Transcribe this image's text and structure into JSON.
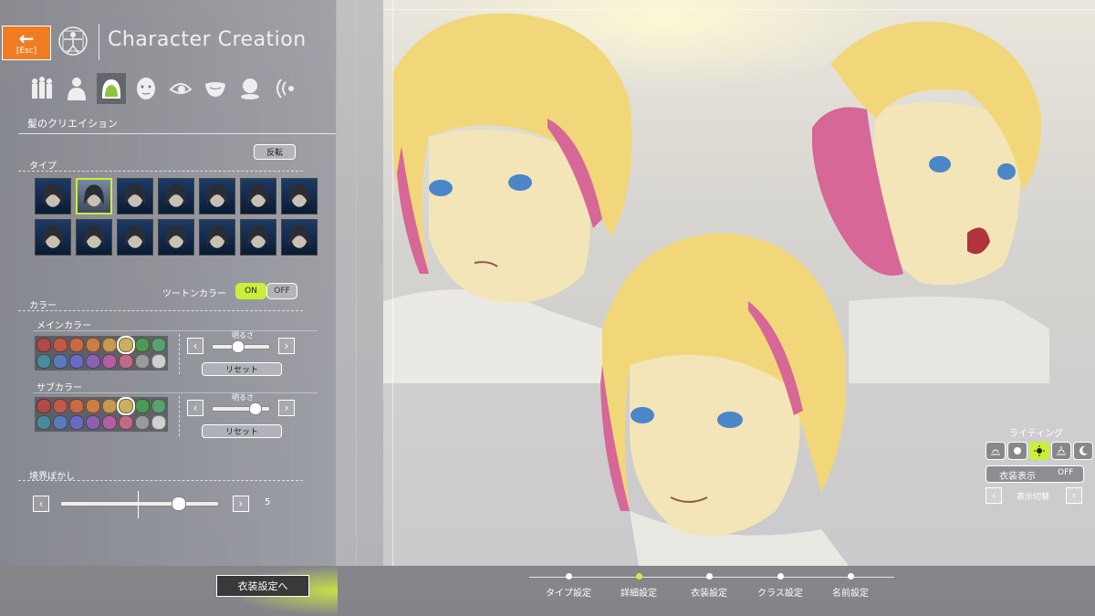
{
  "header": {
    "esc_label": "[Esc]",
    "title": "Character Creation"
  },
  "tabs": [
    {
      "icon": "body-parts-icon",
      "active": false
    },
    {
      "icon": "body-icon",
      "active": false
    },
    {
      "icon": "hair-icon",
      "active": true
    },
    {
      "icon": "face-icon",
      "active": false
    },
    {
      "icon": "eye-icon",
      "active": false
    },
    {
      "icon": "mouth-icon",
      "active": false
    },
    {
      "icon": "makeup-icon",
      "active": false
    },
    {
      "icon": "voice-icon",
      "active": false
    }
  ],
  "panel": {
    "section_title": "髪のクリエイション",
    "flip_button": "反転",
    "type_label": "タイプ",
    "hair_selected_index": 1,
    "two_tone_label": "ツートンカラー",
    "two_tone_on": "ON",
    "two_tone_off": "OFF",
    "color_label": "カラー",
    "main_color_label": "メインカラー",
    "sub_color_label": "サブカラー",
    "brightness_label": "明るさ",
    "reset_label": "リセット",
    "main_brightness": 0.45,
    "sub_brightness": 0.75,
    "blur_label": "境界ぼかし",
    "blur_value": "5",
    "blur_fraction": 0.75
  },
  "swatch_colors": [
    "#b04a4a",
    "#c25a4a",
    "#c86a44",
    "#c87f44",
    "#c89a50",
    "#c8b060",
    "#4e9a54",
    "#5aa070",
    "#4a8a9a",
    "#5a7ab8",
    "#6a6ac0",
    "#8a62b0",
    "#b060a0",
    "#c06a88",
    "#9a9a9a",
    "#d0d0d0"
  ],
  "main_selected": 5,
  "sub_selected": 5,
  "right": {
    "lighting_label": "ライティング",
    "outfit_label": "衣装表示",
    "outfit_value": "OFF",
    "display_switch_label": "表示切替",
    "lighting_selected": 2
  },
  "bottom": {
    "next_button": "衣装設定へ",
    "steps": [
      {
        "label": "タイプ設定",
        "active": false
      },
      {
        "label": "詳細設定",
        "active": true
      },
      {
        "label": "衣装設定",
        "active": false
      },
      {
        "label": "クラス設定",
        "active": false
      },
      {
        "label": "名前設定",
        "active": false
      }
    ]
  }
}
